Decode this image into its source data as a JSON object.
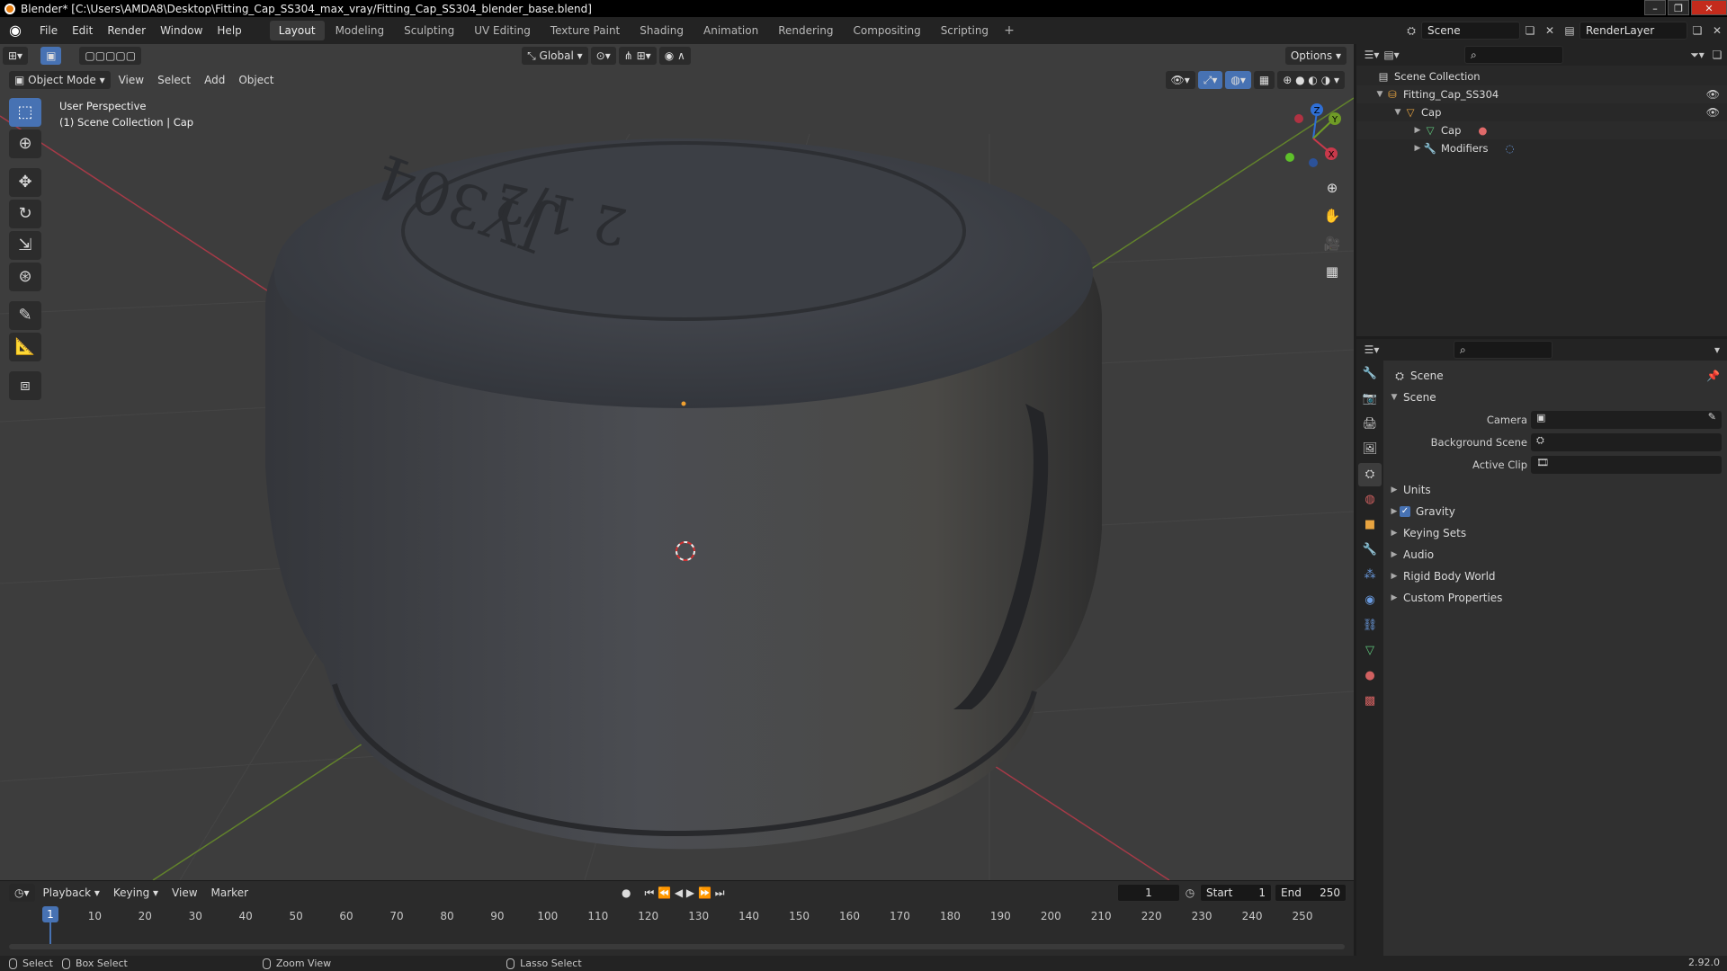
{
  "window": {
    "title": "Blender* [C:\\Users\\AMDA8\\Desktop\\Fitting_Cap_SS304_max_vray/Fitting_Cap_SS304_blender_base.blend]",
    "controls": [
      "–",
      "❐",
      "✕"
    ]
  },
  "menus": [
    "File",
    "Edit",
    "Render",
    "Window",
    "Help"
  ],
  "workspaces": [
    "Layout",
    "Modeling",
    "Sculpting",
    "UV Editing",
    "Texture Paint",
    "Shading",
    "Animation",
    "Rendering",
    "Compositing",
    "Scripting"
  ],
  "workspace_add": "+",
  "topright": {
    "scene": "Scene",
    "render_layer": "RenderLayer"
  },
  "viewport": {
    "mode": "Object Mode",
    "menu": [
      "View",
      "Select",
      "Add",
      "Object"
    ],
    "orientation": "Global",
    "options": "Options",
    "info_line1": "User Perspective",
    "info_line2": "(1) Scene Collection | Cap",
    "gizmo": {
      "z": "Z",
      "y": "Y",
      "x": "X"
    },
    "engraving_line1": "2 1/2",
    "engraving_line2": "JY304"
  },
  "timeline": {
    "menu": [
      "Playback",
      "Keying",
      "View",
      "Marker"
    ],
    "current_frame": "1",
    "start_label": "Start",
    "start": "1",
    "end_label": "End",
    "end": "250",
    "ticks": [
      1,
      10,
      20,
      30,
      40,
      50,
      60,
      70,
      80,
      90,
      100,
      110,
      120,
      130,
      140,
      150,
      160,
      170,
      180,
      190,
      200,
      210,
      220,
      230,
      240,
      250
    ]
  },
  "status": {
    "select": "Select",
    "box_select": "Box Select",
    "zoom_view": "Zoom View",
    "lasso_select": "Lasso Select",
    "version": "2.92.0"
  },
  "outliner": {
    "rows": [
      {
        "label": "Scene Collection"
      },
      {
        "label": "Fitting_Cap_SS304"
      },
      {
        "label": "Cap"
      },
      {
        "label": "Cap"
      },
      {
        "label": "Modifiers"
      }
    ]
  },
  "properties": {
    "title": "Scene",
    "section": "Scene",
    "camera_label": "Camera",
    "background_scene_label": "Background Scene",
    "active_clip_label": "Active Clip",
    "panels": [
      "Units",
      "Gravity",
      "Keying Sets",
      "Audio",
      "Rigid Body World",
      "Custom Properties"
    ]
  },
  "colors": {
    "accent": "#4772b3",
    "viewport_bg": "#3d3d3d",
    "x_axis": "#c9394b",
    "y_axis": "#6f9b26"
  }
}
